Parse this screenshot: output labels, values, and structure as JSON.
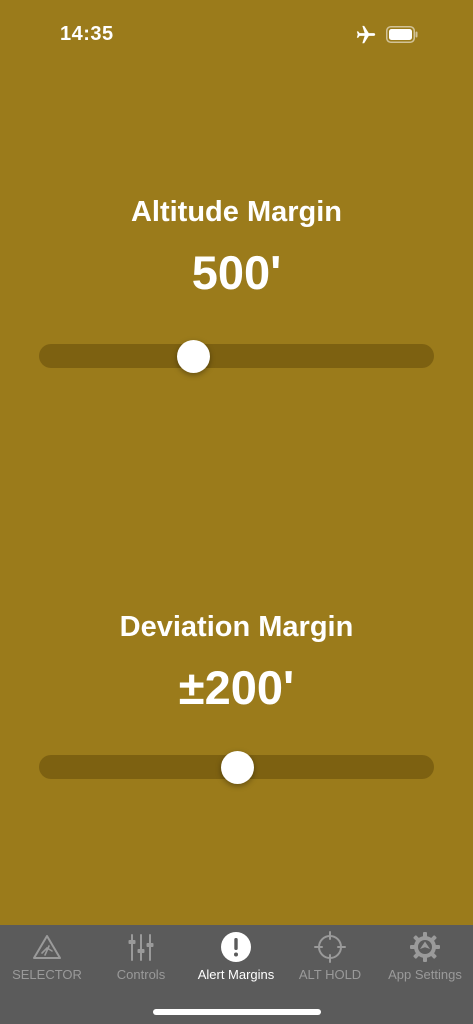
{
  "status_bar": {
    "time": "14:35",
    "airplane_icon": "airplane-icon",
    "battery_icon": "battery-icon"
  },
  "altitude": {
    "title": "Altitude Margin",
    "value": "500'",
    "slider_fraction": 0.39
  },
  "deviation": {
    "title": "Deviation Margin",
    "value": "±200'",
    "slider_fraction": 0.5
  },
  "tabs": [
    {
      "label": "SELECTOR",
      "icon": "selector-triangle-icon",
      "active": false
    },
    {
      "label": "Controls",
      "icon": "sliders-icon",
      "active": false
    },
    {
      "label": "Alert Margins",
      "icon": "exclamation-icon",
      "active": true
    },
    {
      "label": "ALT HOLD",
      "icon": "crosshair-icon",
      "active": false
    },
    {
      "label": "App Settings",
      "icon": "gear-icon",
      "active": false
    }
  ],
  "colors": {
    "background": "#9b7b1b",
    "tab_bar": "#5b5b5b",
    "tab_inactive": "#9a9a9a",
    "tab_active": "#ffffff"
  }
}
